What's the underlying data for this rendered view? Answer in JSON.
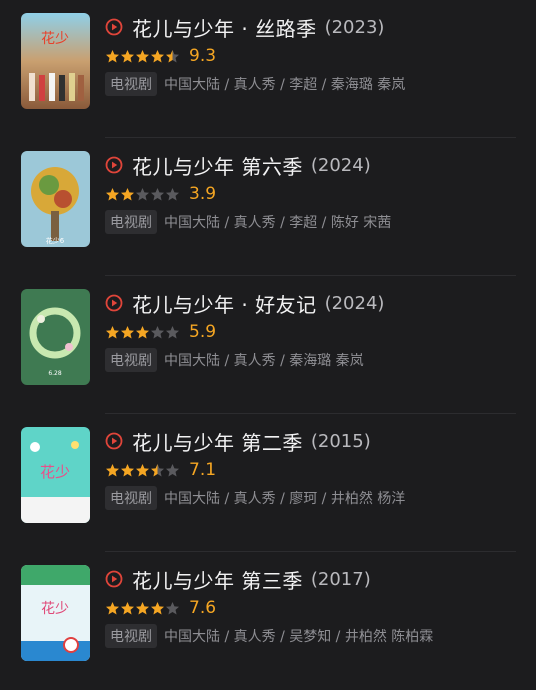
{
  "colors": {
    "accent_red": "#e0453a",
    "star_on": "#f5a623",
    "star_off": "#5a5a5e"
  },
  "items": [
    {
      "title": "花儿与少年 · 丝路季",
      "year": "(2023)",
      "rating": 9.3,
      "stars": 4.5,
      "score": "9.3",
      "tag": "电视剧",
      "meta": "中国大陆 / 真人秀 / 李超 / 秦海璐 秦岚",
      "icon": "play-circle-icon"
    },
    {
      "title": "花儿与少年 第六季",
      "year": "(2024)",
      "rating": 3.9,
      "stars": 2,
      "score": "3.9",
      "tag": "电视剧",
      "meta": "中国大陆 / 真人秀 / 李超 / 陈好 宋茜",
      "icon": "play-circle-icon"
    },
    {
      "title": "花儿与少年 · 好友记",
      "year": "(2024)",
      "rating": 5.9,
      "stars": 3,
      "score": "5.9",
      "tag": "电视剧",
      "meta": "中国大陆 / 真人秀 / 秦海璐 秦岚",
      "icon": "play-circle-icon"
    },
    {
      "title": "花儿与少年 第二季",
      "year": "(2015)",
      "rating": 7.1,
      "stars": 3.5,
      "score": "7.1",
      "tag": "电视剧",
      "meta": "中国大陆 / 真人秀 / 廖珂 / 井柏然 杨洋",
      "icon": "play-circle-icon"
    },
    {
      "title": "花儿与少年 第三季",
      "year": "(2017)",
      "rating": 7.6,
      "stars": 4,
      "score": "7.6",
      "tag": "电视剧",
      "meta": "中国大陆 / 真人秀 / 吴梦知 / 井柏然 陈柏霖",
      "icon": "play-circle-icon"
    }
  ]
}
